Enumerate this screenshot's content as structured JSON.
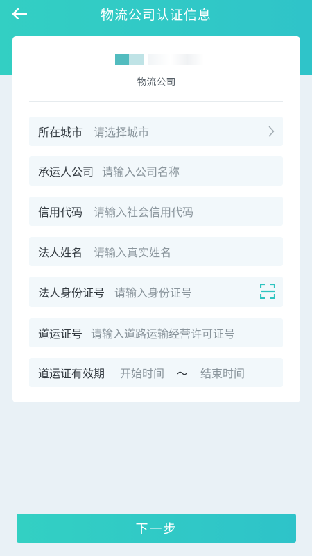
{
  "header": {
    "title": "物流公司认证信息",
    "back_icon": "arrow-left-icon"
  },
  "company": {
    "name": "物流公司"
  },
  "form": {
    "city": {
      "label": "所在城市",
      "placeholder": "请选择城市"
    },
    "carrier_company": {
      "label": "承运人公司",
      "placeholder": "请输入公司名称"
    },
    "credit_code": {
      "label": "信用代码",
      "placeholder": "请输入社会信用代码"
    },
    "legal_name": {
      "label": "法人姓名",
      "placeholder": "请输入真实姓名"
    },
    "legal_id": {
      "label": "法人身份证号",
      "placeholder": "请输入身份证号"
    },
    "transport_license": {
      "label": "道运证号",
      "placeholder": "请输入道路运输经营许可证号"
    },
    "license_validity": {
      "label": "道运证有效期",
      "start": "开始时间",
      "separator": "～",
      "end": "结束时间"
    }
  },
  "footer": {
    "next_label": "下一步"
  },
  "colors": {
    "accent": "#33cfc3",
    "background": "#e9f1f6",
    "row_bg": "#f2f8fb"
  }
}
